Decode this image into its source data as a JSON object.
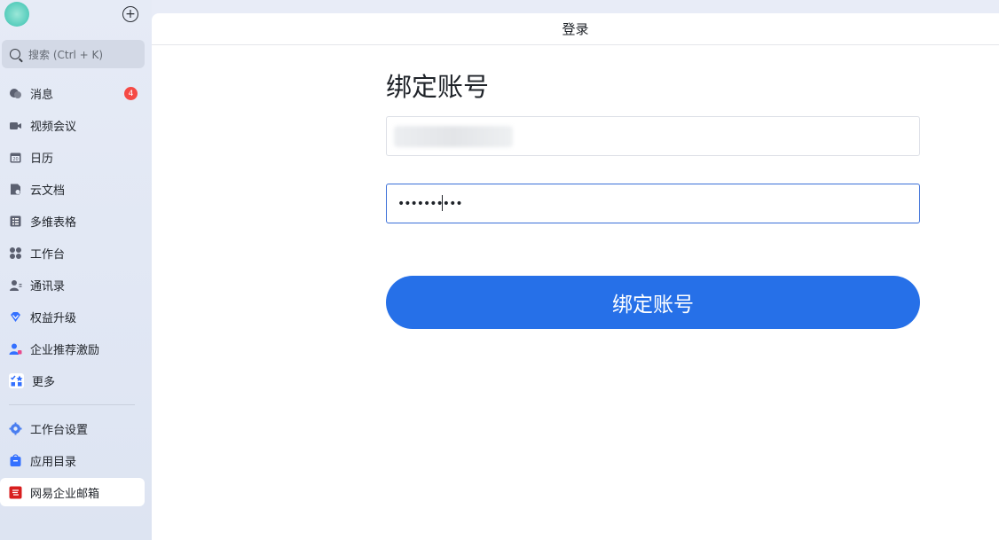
{
  "sidebar": {
    "search_placeholder": "搜索 (Ctrl + K)",
    "items": [
      {
        "label": "消息",
        "icon": "chat-bubble-icon",
        "badge": "4"
      },
      {
        "label": "视频会议",
        "icon": "video-camera-icon"
      },
      {
        "label": "日历",
        "icon": "calendar-icon"
      },
      {
        "label": "云文档",
        "icon": "cloud-doc-icon"
      },
      {
        "label": "多维表格",
        "icon": "table-icon"
      },
      {
        "label": "工作台",
        "icon": "workbench-grid-icon"
      },
      {
        "label": "通讯录",
        "icon": "contacts-icon"
      },
      {
        "label": "权益升级",
        "icon": "diamond-icon"
      },
      {
        "label": "企业推荐激励",
        "icon": "referral-icon"
      },
      {
        "label": "更多",
        "icon": "more-apps-icon"
      }
    ],
    "bottom_items": [
      {
        "label": "工作台设置",
        "icon": "gear-icon"
      },
      {
        "label": "应用目录",
        "icon": "app-bag-icon"
      },
      {
        "label": "网易企业邮箱",
        "icon": "netease-mail-icon"
      }
    ]
  },
  "main": {
    "tab_title": "登录",
    "heading": "绑定账号",
    "account_value": "",
    "password_value": "••••••••••",
    "submit_label": "绑定账号"
  },
  "colors": {
    "primary": "#2670e8",
    "badge": "#f54a45",
    "sidebar_bg": "#e6ebf6"
  }
}
